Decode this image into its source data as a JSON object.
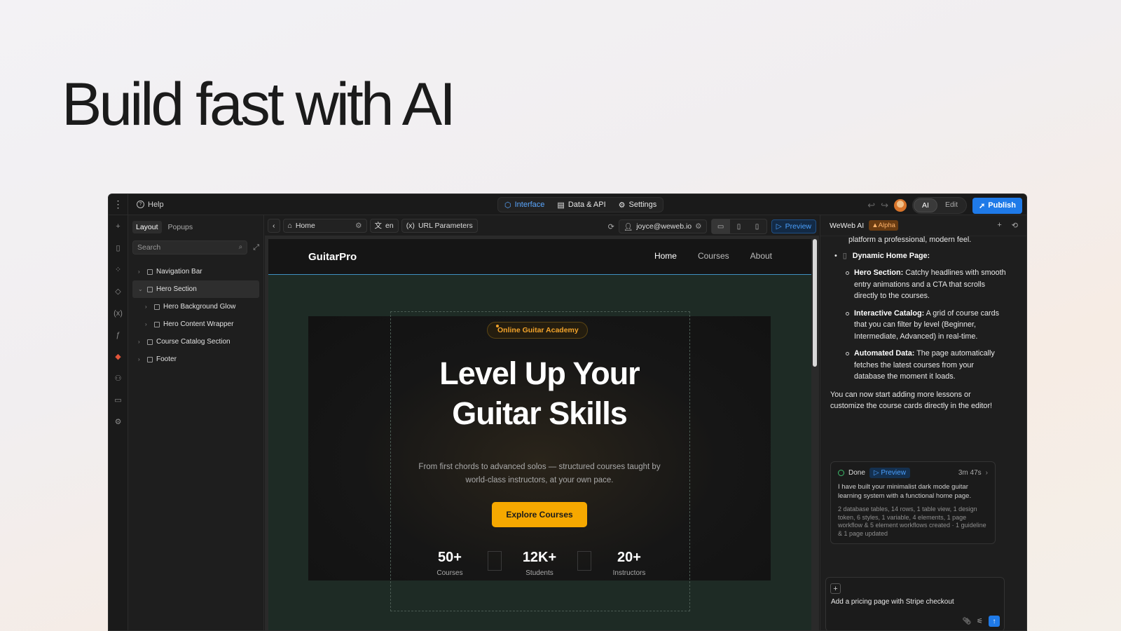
{
  "headline": "Build fast with AI",
  "topbar": {
    "help": "Help",
    "tabs": [
      {
        "label": "Interface"
      },
      {
        "label": "Data & API"
      },
      {
        "label": "Settings"
      }
    ],
    "mode_ai": "AI",
    "mode_edit": "Edit",
    "publish": "Publish"
  },
  "layers": {
    "tabs": [
      "Layout",
      "Popups"
    ],
    "search_placeholder": "Search",
    "nodes": [
      "Navigation Bar",
      "Hero Section",
      "Hero Background Glow",
      "Hero Content Wrapper",
      "Course Catalog Section",
      "Footer"
    ]
  },
  "canvasbar": {
    "page": "Home",
    "lang": "en",
    "params": "URL Parameters",
    "user": "joyce@weweb.io",
    "preview": "Preview"
  },
  "site": {
    "logo": "GuitarPro",
    "nav": [
      "Home",
      "Courses",
      "About"
    ],
    "badge": "Online Guitar Academy",
    "title_line1": "Level Up Your",
    "title_line2": "Guitar Skills",
    "subtitle_line1": "From first chords to advanced solos — structured courses taught by",
    "subtitle_line2": "world-class instructors, at your own pace.",
    "cta": "Explore Courses",
    "stats": [
      {
        "value": "50+",
        "label": "Courses"
      },
      {
        "value": "12K+",
        "label": "Students"
      },
      {
        "value": "20+",
        "label": "Instructors"
      }
    ]
  },
  "ai": {
    "title": "WeWeb AI",
    "badge": "Alpha",
    "cut_text": "platform a professional, modern feel.",
    "heading": "Dynamic Home Page:",
    "items": [
      {
        "bold": "Hero Section:",
        "text": " Catchy headlines with smooth entry animations and a CTA that scrolls directly to the courses."
      },
      {
        "bold": "Interactive Catalog:",
        "text": " A grid of course cards that you can filter by level (Beginner, Intermediate, Advanced) in real-time."
      },
      {
        "bold": "Automated Data:",
        "text": " The page automatically fetches the latest courses from your database the moment it loads."
      }
    ],
    "closing": "You can now start adding more lessons or customize the course cards directly in the editor!",
    "done_label": "Done",
    "done_preview": "Preview",
    "done_time": "3m 47s",
    "done_summary": "I have built your minimalist dark mode guitar learning system with a functional home page.",
    "done_stats": "2 database tables, 14 rows, 1 table view, 1 design token, 6 styles, 1 variable, 4 elements, 1 page workflow & 5 element workflows created · 1 guideline & 1 page updated",
    "input_text": "Add a pricing page with Stripe checkout"
  }
}
